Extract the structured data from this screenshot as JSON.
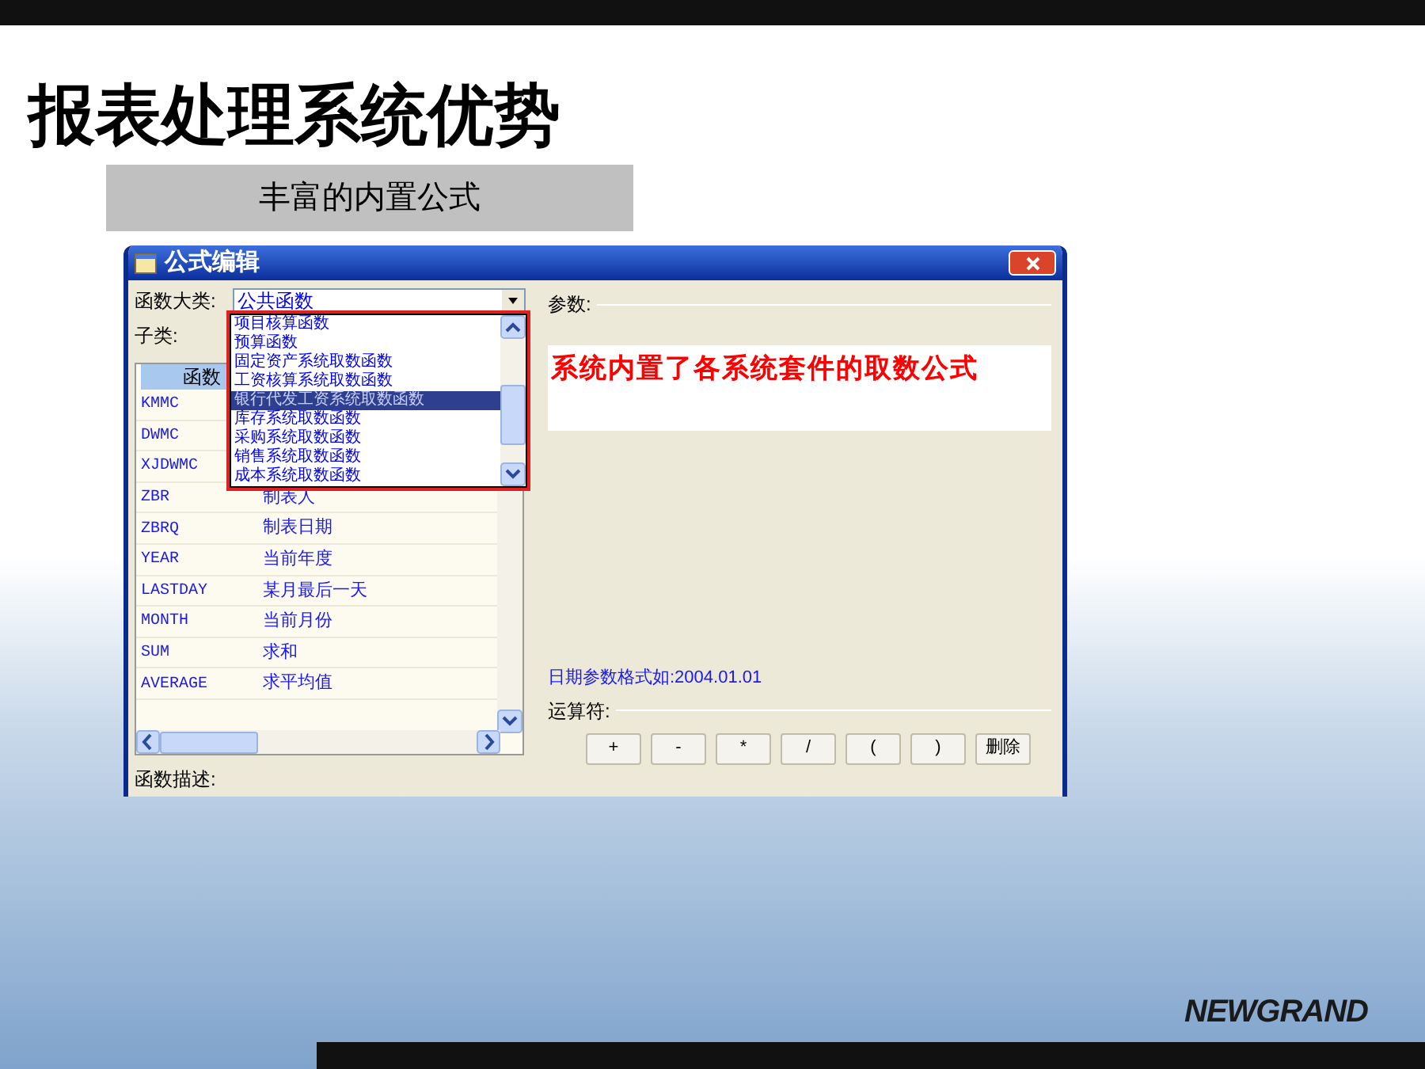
{
  "slide": {
    "title": "报表处理系统优势",
    "subtitle": "丰富的内置公式",
    "callout": "系统内置了各系统套件的取数公式",
    "logo": "NEWGRAND"
  },
  "dialog": {
    "title": "公式编辑",
    "category_label": "函数大类:",
    "category_value": "公共函数",
    "dropdown_items": [
      {
        "label": "项目核算函数",
        "selected": false
      },
      {
        "label": "预算函数",
        "selected": false
      },
      {
        "label": "固定资产系统取数函数",
        "selected": false
      },
      {
        "label": "工资核算系统取数函数",
        "selected": false
      },
      {
        "label": "银行代发工资系统取数函数",
        "selected": true
      },
      {
        "label": "库存系统取数函数",
        "selected": false
      },
      {
        "label": "采购系统取数函数",
        "selected": false
      },
      {
        "label": "销售系统取数函数",
        "selected": false
      },
      {
        "label": "成本系统取数函数",
        "selected": false
      }
    ],
    "subcategory_label": "子类:",
    "table": {
      "columns": [
        "函数"
      ],
      "rows": [
        {
          "cells": [
            "KMMC"
          ]
        },
        {
          "cells": [
            "DWMC"
          ]
        },
        {
          "cells": [
            "XJDWMC"
          ]
        },
        {
          "cells": [
            "ZBR",
            "制表人"
          ]
        },
        {
          "cells": [
            "ZBRQ",
            "制表日期"
          ]
        },
        {
          "cells": [
            "YEAR",
            "当前年度"
          ]
        },
        {
          "cells": [
            "LASTDAY",
            "某月最后一天"
          ]
        },
        {
          "cells": [
            "MONTH",
            "当前月份"
          ]
        },
        {
          "cells": [
            "SUM",
            "求和"
          ]
        },
        {
          "cells": [
            "AVERAGE",
            "求平均值"
          ]
        }
      ]
    },
    "description_label": "函数描述:",
    "params_label": "参数:",
    "date_hint": "日期参数格式如:2004.01.01",
    "operators_label": "运算符:",
    "operators": [
      "+",
      "-",
      "*",
      "/",
      "(",
      ")",
      "删除"
    ]
  }
}
